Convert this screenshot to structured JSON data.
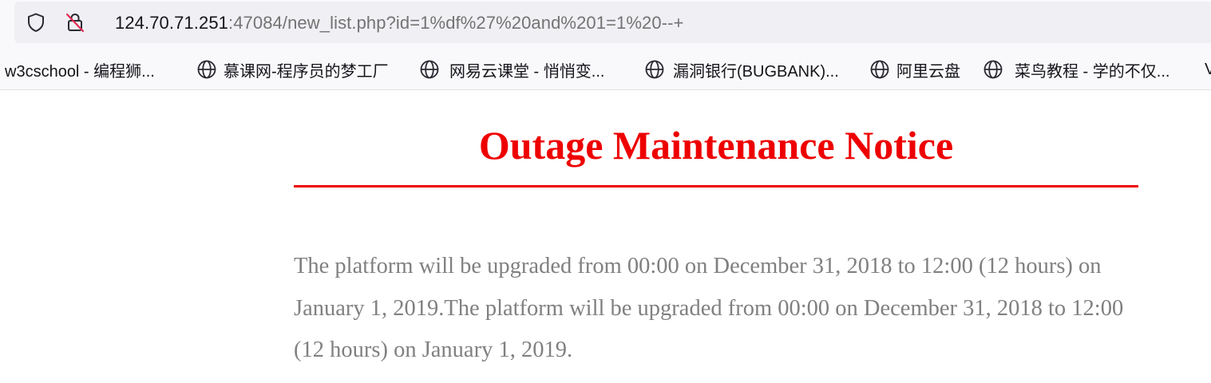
{
  "browser": {
    "url_host": "124.70.71.251",
    "url_rest": ":47084/new_list.php?id=1%df%27%20and%201=1%20--+",
    "icons": {
      "tracking_protection": "shield-icon",
      "connection": "insecure-lock-icon"
    }
  },
  "bookmarks": [
    {
      "label": "w3cschool - 编程狮...",
      "icon": "none"
    },
    {
      "label": "慕课网-程序员的梦工厂",
      "icon": "globe-icon"
    },
    {
      "label": "网易云课堂 - 悄悄变...",
      "icon": "globe-icon"
    },
    {
      "label": "漏洞银行(BUGBANK)...",
      "icon": "globe-icon"
    },
    {
      "label": "阿里云盘",
      "icon": "globe-icon"
    },
    {
      "label": "菜鸟教程 - 学的不仅...",
      "icon": "globe-icon"
    },
    {
      "label": "V",
      "icon": "none"
    }
  ],
  "page": {
    "title": "Outage Maintenance Notice",
    "body": "The platform will be upgraded from 00:00 on December 31, 2018 to 12:00 (12 hours) on January 1, 2019.The platform will be upgraded from 00:00 on December 31, 2018 to 12:00 (12 hours) on January 1, 2019.",
    "colors": {
      "title": "#ee0000",
      "rule": "#ee0000",
      "body": "#808080"
    }
  }
}
